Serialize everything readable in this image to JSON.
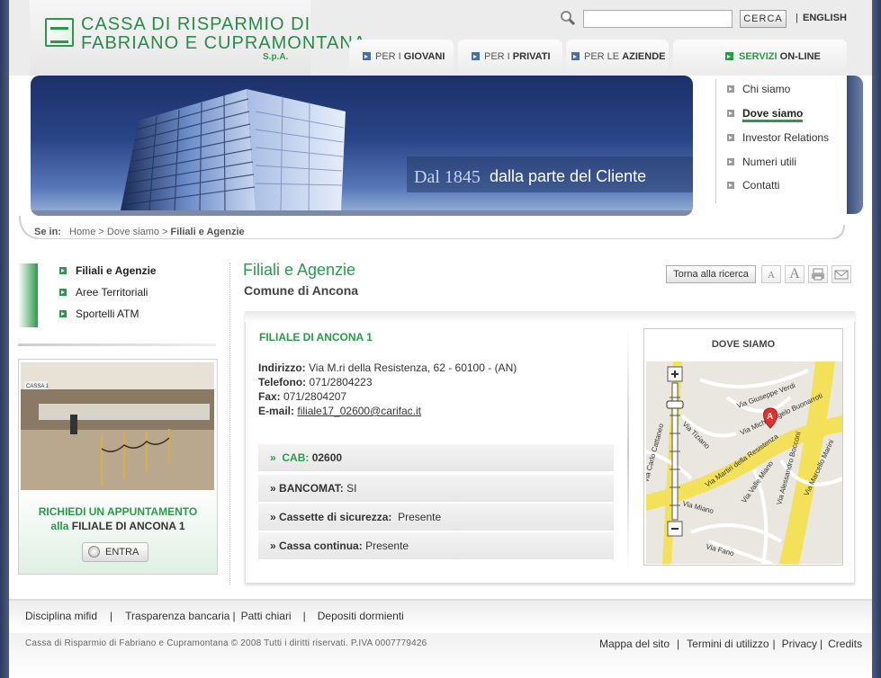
{
  "header": {
    "logo_line1": "CASSA DI RISPARMIO DI",
    "logo_line2": "FABRIANO E CUPRAMONTANA",
    "logo_spa": "S.p.A.",
    "search_value": "",
    "search_button": "CERCA",
    "separator": "|",
    "language_link": "ENGLISH"
  },
  "nav": {
    "tabs": [
      {
        "prefix": "PER I ",
        "label": "GIOVANI"
      },
      {
        "prefix": "PER I ",
        "label": "PRIVATI"
      },
      {
        "prefix": "PER LE ",
        "label": "AZIENDE"
      }
    ],
    "services": {
      "bold": "SERVIZI",
      "rest": " ON-LINE"
    }
  },
  "hero": {
    "year": "Dal 1845",
    "slogan": "dalla parte del Cliente"
  },
  "right_menu": [
    "Chi siamo",
    "Dove siamo",
    "Investor Relations",
    "Numeri utili",
    "Contatti"
  ],
  "breadcrumb": {
    "label": "Se in:",
    "home": "Home",
    "sep1": " > ",
    "dove": "Dove siamo",
    "sep2": " > ",
    "current": "Filiali e Agenzie"
  },
  "left_menu": [
    "Filiali e Agenzie",
    "Aree Territoriali",
    "Sportelli ATM"
  ],
  "promo": {
    "line1": "RICHIEDI UN APPUNTAMENTO",
    "line2_prefix": "alla ",
    "line2_bold": "FILIALE DI ANCONA 1",
    "button": "ENTRA",
    "sign_text": "CASSA 1"
  },
  "content": {
    "title": "Filiali e Agenzie",
    "subtitle": "Comune di Ancona",
    "back_button": "Torna alla ricerca",
    "tools": [
      "A",
      "A"
    ]
  },
  "branch": {
    "name": "FILIALE DI ANCONA 1",
    "address_label": "Indirizzo:",
    "address": "Via M.ri della Resistenza, 62 - 60100 - (AN)",
    "phone_label": "Telefono:",
    "phone": "071/2804223",
    "fax_label": "Fax:",
    "fax": "071/2804207",
    "email_label": "E-mail:",
    "email": "filiale17_02600@carifac.it",
    "cab_label": "CAB:",
    "cab": "02600",
    "bancomat_label": "BANCOMAT:",
    "bancomat": "SI",
    "cassette_label": "Cassette di sicurezza:",
    "cassette": "Presente",
    "cassa_label": "Cassa continua:",
    "cassa": "Presente",
    "bullet": "»"
  },
  "map": {
    "title": "DOVE SIAMO",
    "marker": "A",
    "streets": [
      "Via Giuseppe Verdi",
      "Via Michelangelo Buonarroti",
      "Via Tiziano",
      "Via Martiri della Resistenza",
      "Via Alessandro Bocconi",
      "Via Valle Miano",
      "Via Marcello Marini",
      "Via Fano",
      "Via Miano",
      "Via Carlo Cattaneo"
    ]
  },
  "footer": {
    "links": [
      "Disciplina mifid",
      "Trasparenza bancaria",
      "Patti chiari",
      "Depositi dormienti"
    ],
    "copyright": "Cassa di Risparmio di Fabriano e Cupramontana © 2008 Tutti i diritti riservati. P.IVA 0007779426",
    "right_links": [
      "Mappa del sito",
      "Termini di utilizzo",
      "Privacy",
      "Credits"
    ]
  },
  "colors": {
    "accent": "#2a9a4a",
    "nav_blue": "#4a6fa5"
  }
}
